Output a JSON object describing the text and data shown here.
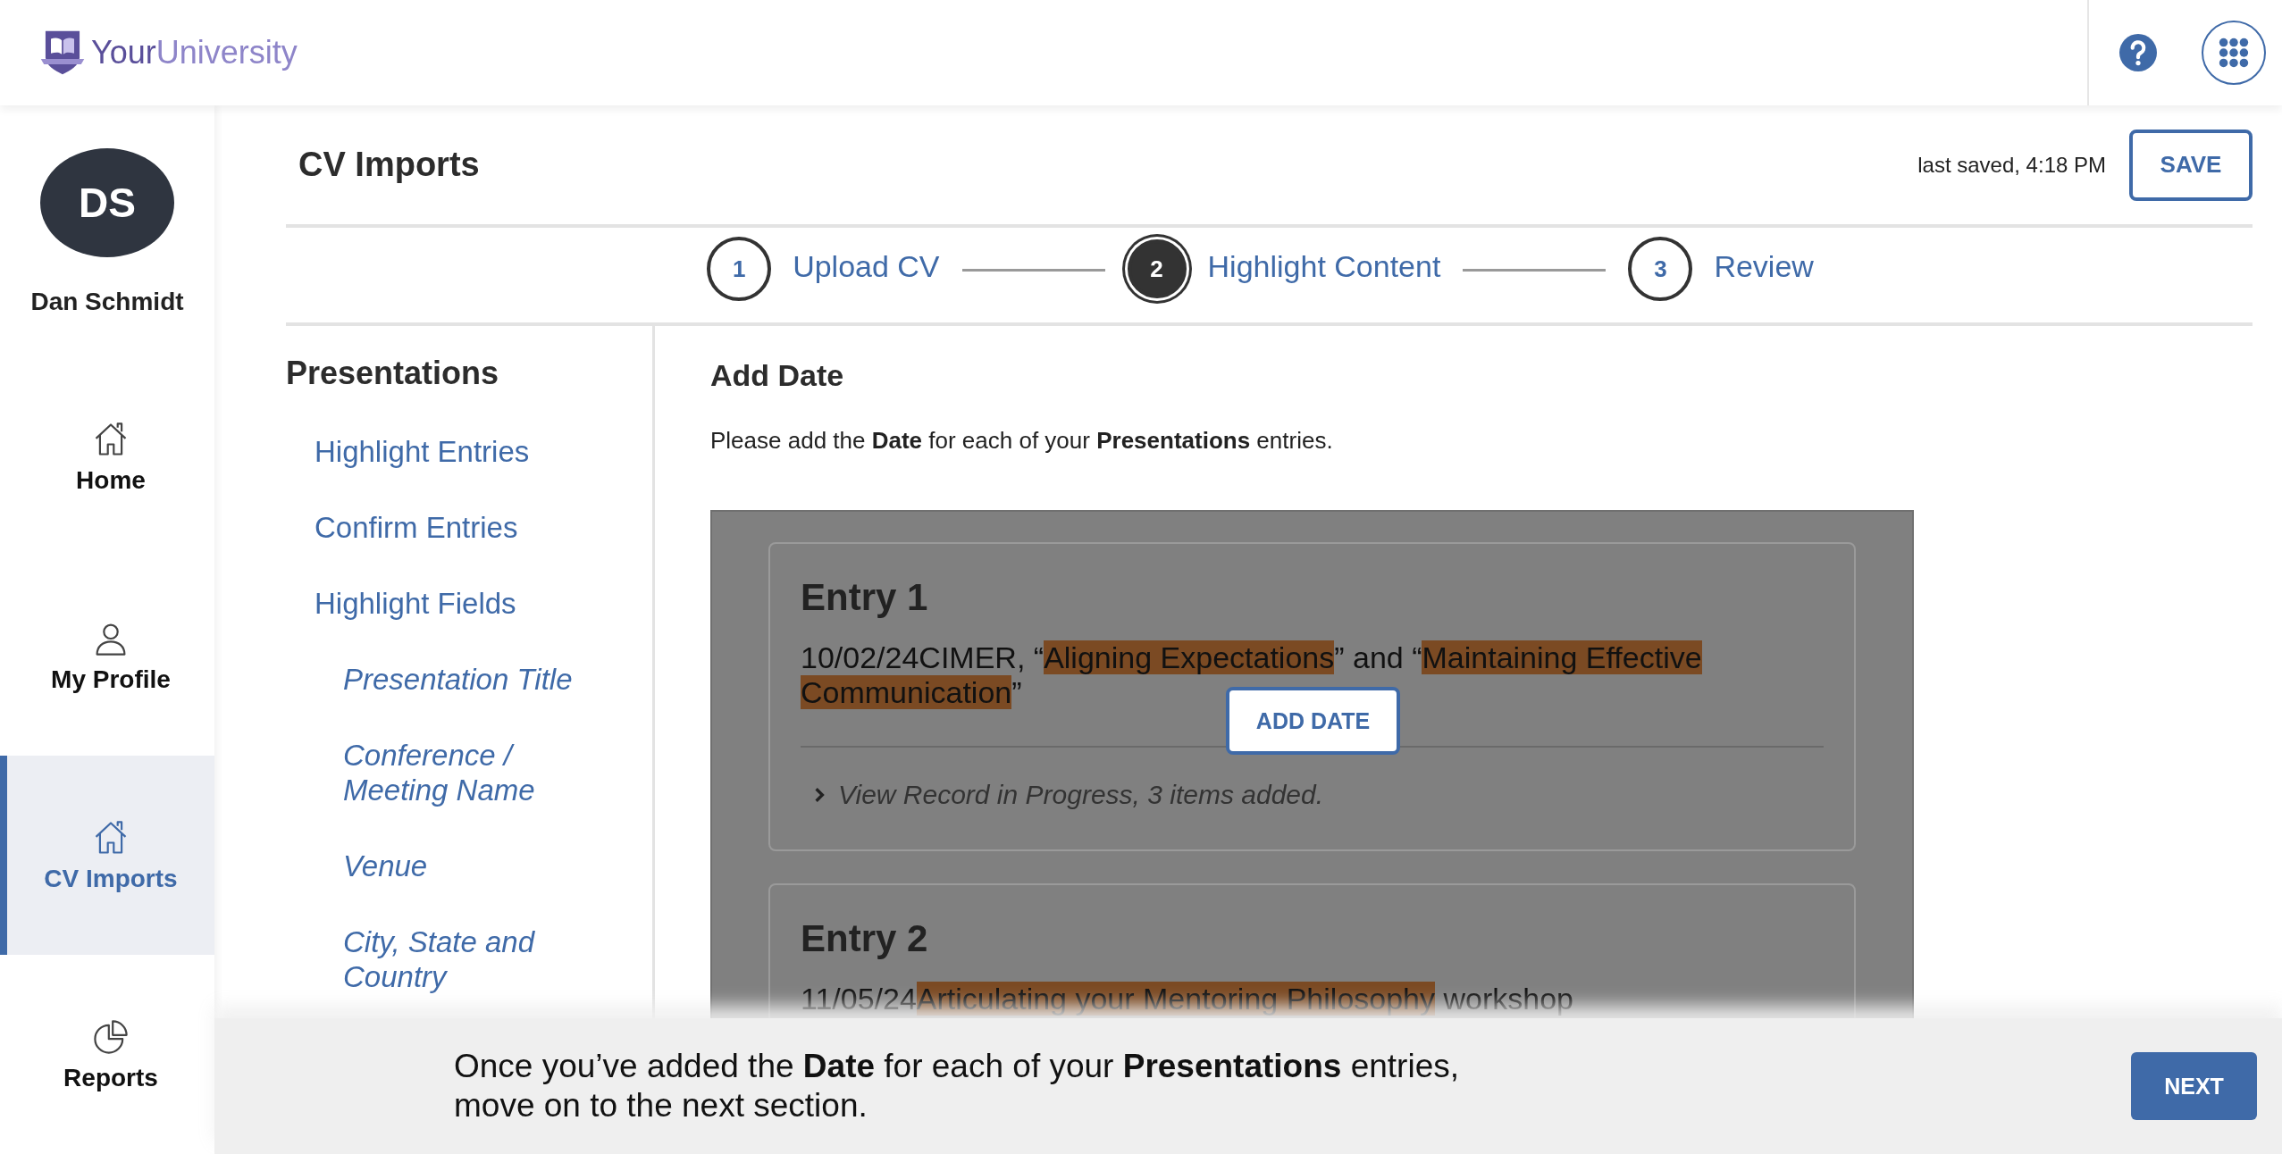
{
  "header": {
    "logo": {
      "first": "Your",
      "second": "University"
    }
  },
  "user": {
    "initials": "DS",
    "name": "Dan Schmidt"
  },
  "nav": [
    {
      "label": "Home",
      "kind": "home",
      "selected": false
    },
    {
      "label": "My Profile",
      "kind": "profile",
      "selected": false
    },
    {
      "label": "CV Imports",
      "kind": "imports",
      "selected": true
    },
    {
      "label": "Reports",
      "kind": "reports",
      "selected": false
    }
  ],
  "page": {
    "title": "CV Imports",
    "last_saved": "last saved, 4:18 PM",
    "save_button": "SAVE"
  },
  "steps": [
    {
      "number": "1",
      "label": "Upload CV",
      "selected": false
    },
    {
      "number": "2",
      "label": "Highlight Content",
      "selected": true
    },
    {
      "number": "3",
      "label": "Review",
      "selected": false
    }
  ],
  "section_nav": {
    "title": "Presentations",
    "items": [
      {
        "label": "Highlight Entries"
      },
      {
        "label": "Confirm Entries"
      },
      {
        "label": "Highlight Fields",
        "children": [
          {
            "label": "Presentation Title"
          },
          {
            "label": "Conference / Meeting Name"
          },
          {
            "label": "Venue"
          },
          {
            "label": "City, State and Country"
          }
        ]
      }
    ]
  },
  "content": {
    "title": "Add Date",
    "instructions": "Please add the **Date** for each of your **Presentations** entries.",
    "add_button": "ADD DATE",
    "entries": [
      {
        "title": "Entry 1",
        "segments": [
          {
            "text": "10/02/24CIMER, “",
            "highlighted": false
          },
          {
            "text": "Aligning Expectations",
            "highlighted": true
          },
          {
            "text": "” and “",
            "highlighted": false
          },
          {
            "text": "Maintaining Effective Communication",
            "highlighted": true
          },
          {
            "text": "”",
            "highlighted": false
          }
        ],
        "record": {
          "text": "View Record in Progress, 3 items added.",
          "expanded": false
        }
      },
      {
        "title": "Entry 2",
        "segments": [
          {
            "text": "11/05/24",
            "highlighted": false
          },
          {
            "text": "Articulating your Mentoring Philosophy",
            "highlighted": true
          },
          {
            "text": " workshop",
            "highlighted": false
          }
        ]
      }
    ]
  },
  "footer": {
    "message": "Once you’ve added the **Date** for each of your **Presentations** entries, move on to the next section.",
    "next_button": "NEXT"
  }
}
